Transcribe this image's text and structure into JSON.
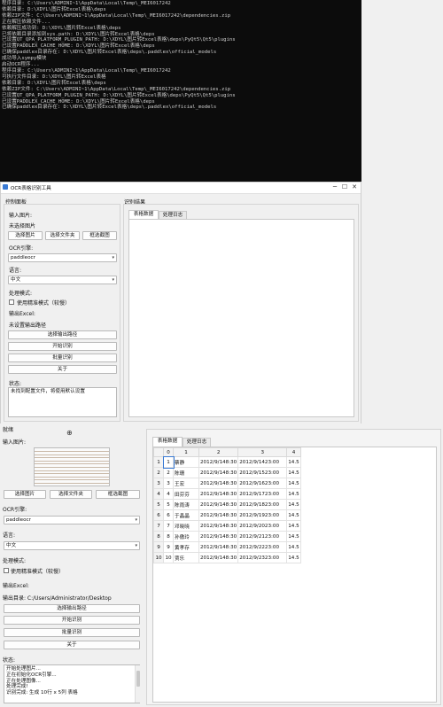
{
  "console": {
    "lines": [
      "程序目录: C:\\Users\\ADMINI~1\\AppData\\Local\\Temp\\_MEI6017242",
      "依赖目录: D:\\XDYL\\图片转Excel表格\\deps",
      "依赖ZIP文件: C:\\Users\\ADMINI~1\\AppData\\Local\\Temp\\_MEI6017242\\dependencies.zip",
      "正在解压依赖文件...",
      "依赖解压成功到: D:\\XDYL\\图片转Excel表格\\deps",
      "已将依赖目录添加到sys.path: D:\\XDYL\\图片转Excel表格\\deps",
      "已设置QT_QPA_PLATFORM_PLUGIN_PATH: D:\\XDYL\\图片转Excel表格\\deps\\PyQt5\\Qt5\\plugins",
      "已设置PADDLEX_CACHE_HOME: D:\\XDYL\\图片转Excel表格\\deps",
      "已确保paddlex目录存在: D:\\XDYL\\图片转Excel表格\\deps\\.paddlex\\official_models",
      "成功导入sympy模块",
      "启动OCR程序...",
      "程序目录: C:\\Users\\ADMINI~1\\AppData\\Local\\Temp\\_MEI6017242",
      "可执行文件目录: D:\\XDYL\\图片转Excel表格",
      "依赖目录: D:\\XDYL\\图片转Excel表格\\deps",
      "依赖ZIP文件: C:\\Users\\ADMINI~1\\AppData\\Local\\Temp\\_MEI6017242\\dependencies.zip",
      "已设置QT_QPA_PLATFORM_PLUGIN_PATH: D:\\XDYL\\图片转Excel表格\\deps\\PyQt5\\Qt5\\plugins",
      "已设置PADDLEX_CACHE_HOME: D:\\XDYL\\图片转Excel表格\\deps",
      "已确保paddlex目录存在: D:\\XDYL\\图片转Excel表格\\deps\\.paddlex\\official_models"
    ]
  },
  "window1": {
    "title": "OCR表格识别工具",
    "minimize": "─",
    "maximize": "☐",
    "close": "✕",
    "control_panel": "控制面板",
    "input_image_label": "输入图片:",
    "no_image": "未选择图片",
    "btn_select_image": "选择图片",
    "btn_select_folder": "选择文件夹",
    "btn_crop": "框选截图",
    "engine_label": "OCR引擎:",
    "engine_value": "paddleocr",
    "language_label": "语言:",
    "language_value": "中文",
    "mode_label": "处理模式:",
    "precise_mode": "使用精准模式（较慢）",
    "output_label": "输出Excel:",
    "no_output": "未设置输出路径",
    "btn_select_output": "选择输出路径",
    "btn_start": "开始识别",
    "btn_batch": "批量识别",
    "btn_about": "关于",
    "status_label": "状态:",
    "status_text": "未找到配置文件，将使用默认设置",
    "results_label": "识别结果",
    "tab_table": "表格数据",
    "tab_log": "处理日志"
  },
  "window2": {
    "ready": "就绪",
    "input_image_label": "输入图片:",
    "btn_select_image": "选择图片",
    "btn_select_folder": "选择文件夹",
    "btn_crop": "框选截图",
    "engine_label": "OCR引擎:",
    "engine_value": "paddleocr",
    "language_label": "语言:",
    "language_value": "中文",
    "mode_label": "处理模式:",
    "precise_mode": "使用精准模式（较慢）",
    "output_label": "输出Excel:",
    "output_path": "输出目录: C:/Users/Administrator/Desktop",
    "btn_select_output": "选择输出路径",
    "btn_start": "开始识别",
    "btn_batch": "批量识别",
    "btn_about": "关于",
    "status_label": "状态:",
    "status_lines": [
      "开始处理图片...",
      "正在初始化OCR引擎...",
      "正在处理图像...",
      "处理完成!",
      "识别完成: 生成 10行 x 5列 表格"
    ],
    "tab_table": "表格数据",
    "tab_log": "处理日志",
    "table_headers": [
      "0",
      "1",
      "2",
      "3",
      "4"
    ],
    "table_rows": [
      [
        "1",
        "蔡静",
        "2012/9/148:30",
        "2012/9/1423:00",
        "14.5"
      ],
      [
        "2",
        "陈珊",
        "2012/9/148:30",
        "2012/9/1523:00",
        "14.5"
      ],
      [
        "3",
        "王宏",
        "2012/9/148:30",
        "2012/9/1623:00",
        "14.5"
      ],
      [
        "4",
        "田芬芬",
        "2012/9/148:30",
        "2012/9/1723:00",
        "14.5"
      ],
      [
        "5",
        "陈雨涛",
        "2012/9/148:30",
        "2012/9/1823:00",
        "14.5"
      ],
      [
        "6",
        "于晶晶",
        "2012/9/148:30",
        "2012/9/1923:00",
        "14.5"
      ],
      [
        "7",
        "邓晓晓",
        "2012/9/148:30",
        "2012/9/2023:00",
        "14.5"
      ],
      [
        "8",
        "孙傲玲",
        "2012/9/148:30",
        "2012/9/2123:00",
        "14.5"
      ],
      [
        "9",
        "黄孝存",
        "2012/9/148:30",
        "2012/9/2223:00",
        "14.5"
      ],
      [
        "10",
        "贾乐",
        "2012/9/148:30",
        "2012/9/2323:00",
        "14.5"
      ]
    ],
    "row_headers": [
      "1",
      "2",
      "3",
      "4",
      "5",
      "6",
      "7",
      "8",
      "9",
      "10"
    ]
  }
}
